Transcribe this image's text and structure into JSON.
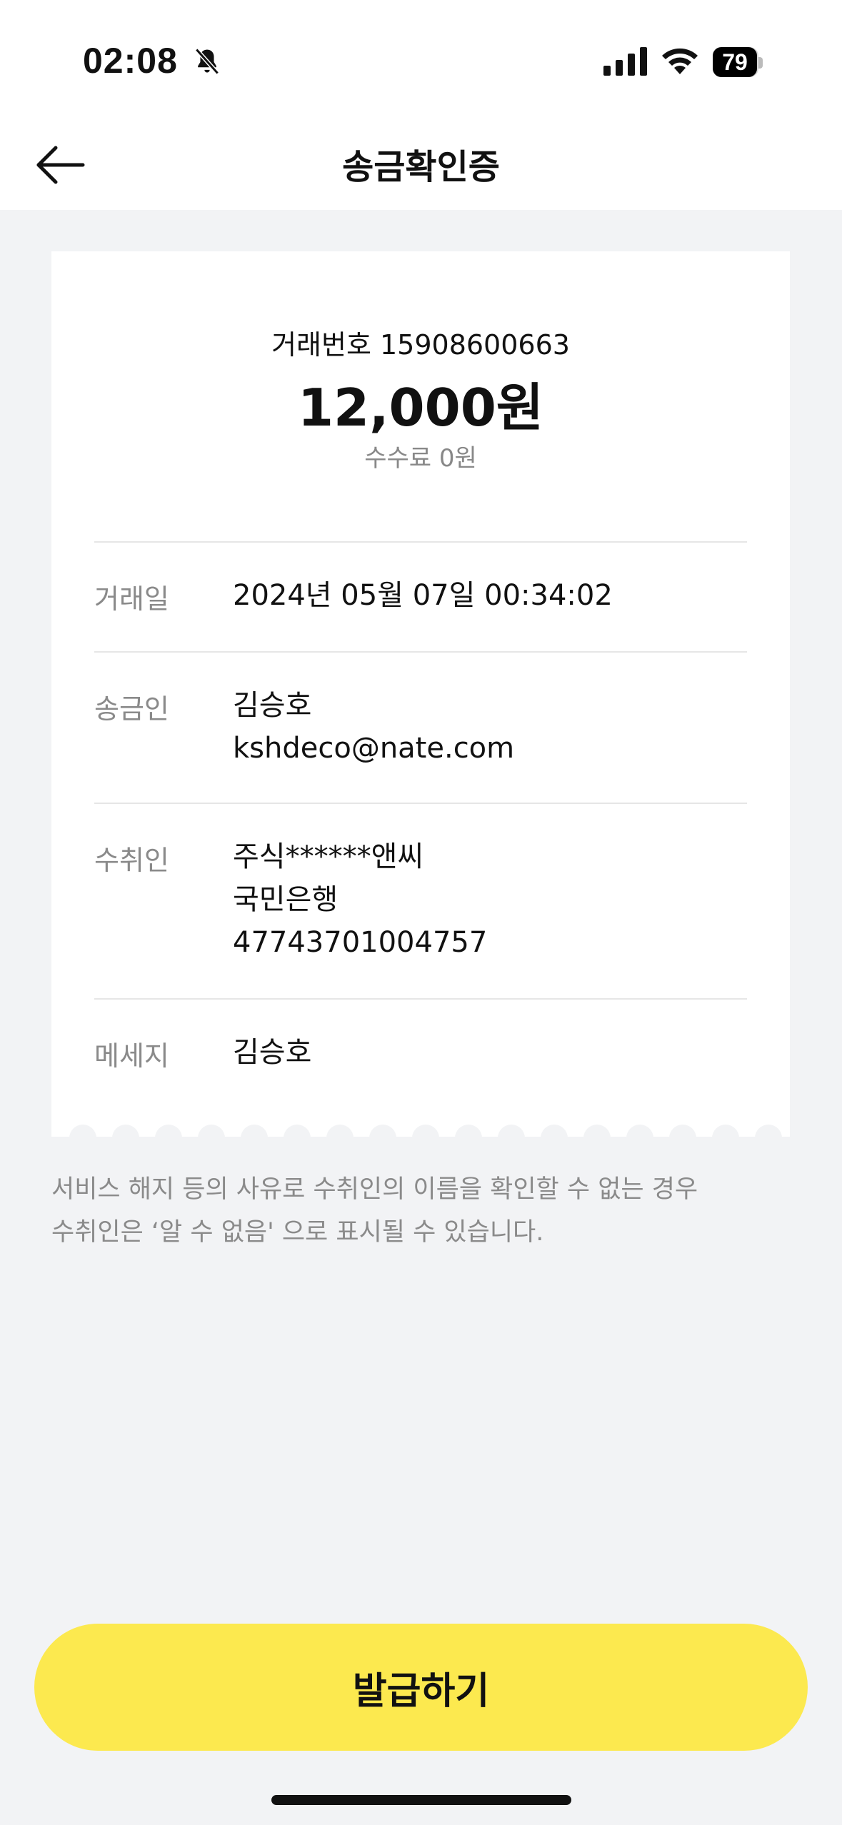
{
  "status_bar": {
    "time": "02:08",
    "battery": "79"
  },
  "nav": {
    "title": "송금확인증"
  },
  "receipt": {
    "transaction_no": "거래번호 15908600663",
    "amount": "12,000원",
    "fee": "수수료 0원",
    "rows": [
      {
        "label": "거래일",
        "lines": [
          "2024년 05월 07일 00:34:02"
        ]
      },
      {
        "label": "송금인",
        "lines": [
          "김승호",
          "kshdeco@nate.com"
        ]
      },
      {
        "label": "수취인",
        "lines": [
          "주식******앤씨",
          "국민은행",
          "47743701004757"
        ]
      },
      {
        "label": "메세지",
        "lines": [
          "김승호"
        ]
      }
    ]
  },
  "notice": {
    "line1": "서비스 해지 등의 사유로 수취인의 이름을 확인할 수 없는 경우",
    "line2": "수취인은 ‘알 수 없음' 으로 표시될 수 있습니다."
  },
  "cta": {
    "label": "발급하기",
    "color": "#fce94f"
  }
}
